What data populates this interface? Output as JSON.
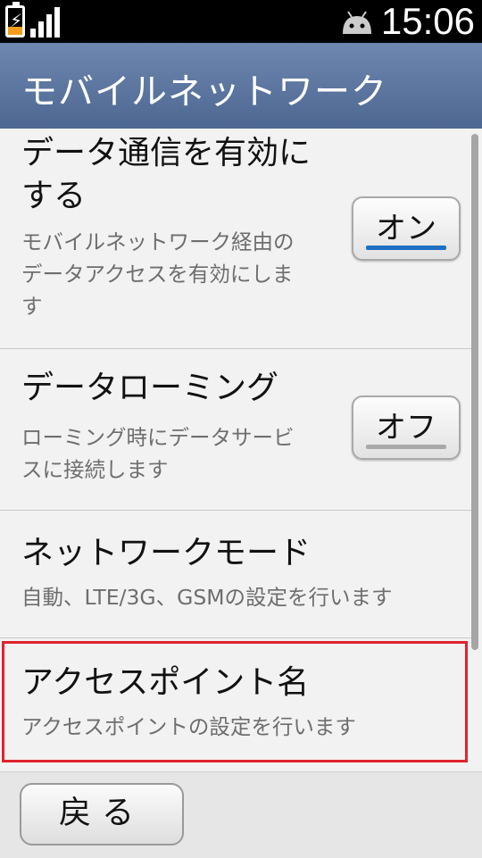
{
  "status_bar": {
    "time": "15:06",
    "icons": [
      "battery-charging-icon",
      "signal-strength-icon",
      "android-icon"
    ],
    "battery_color": "#f59b1a"
  },
  "header": {
    "title": "モバイルネットワーク"
  },
  "settings": {
    "items": [
      {
        "title_lines": [
          "データ通信を有効に",
          "する"
        ],
        "summary_lines": [
          "モバイルネットワーク経由の",
          "データアクセスを有効にしま",
          "す"
        ],
        "toggle": {
          "label": "オン",
          "state": "on",
          "indicator_color": "#1f6fc4"
        }
      },
      {
        "title_lines": [
          "データローミング"
        ],
        "summary_lines": [
          "ローミング時にデータサービ",
          "スに接続します"
        ],
        "toggle": {
          "label": "オフ",
          "state": "off",
          "indicator_color": "#a9a9a9"
        }
      },
      {
        "title_lines": [
          "ネットワークモード"
        ],
        "summary_lines": [
          "自動、LTE/3G、GSMの設定を行います"
        ]
      },
      {
        "title_lines": [
          "アクセスポイント名"
        ],
        "summary_lines": [
          "アクセスポイントの設定を行います"
        ],
        "highlighted": true,
        "highlight_color": "#e0232d"
      }
    ]
  },
  "footer": {
    "back_label": "戻る"
  }
}
